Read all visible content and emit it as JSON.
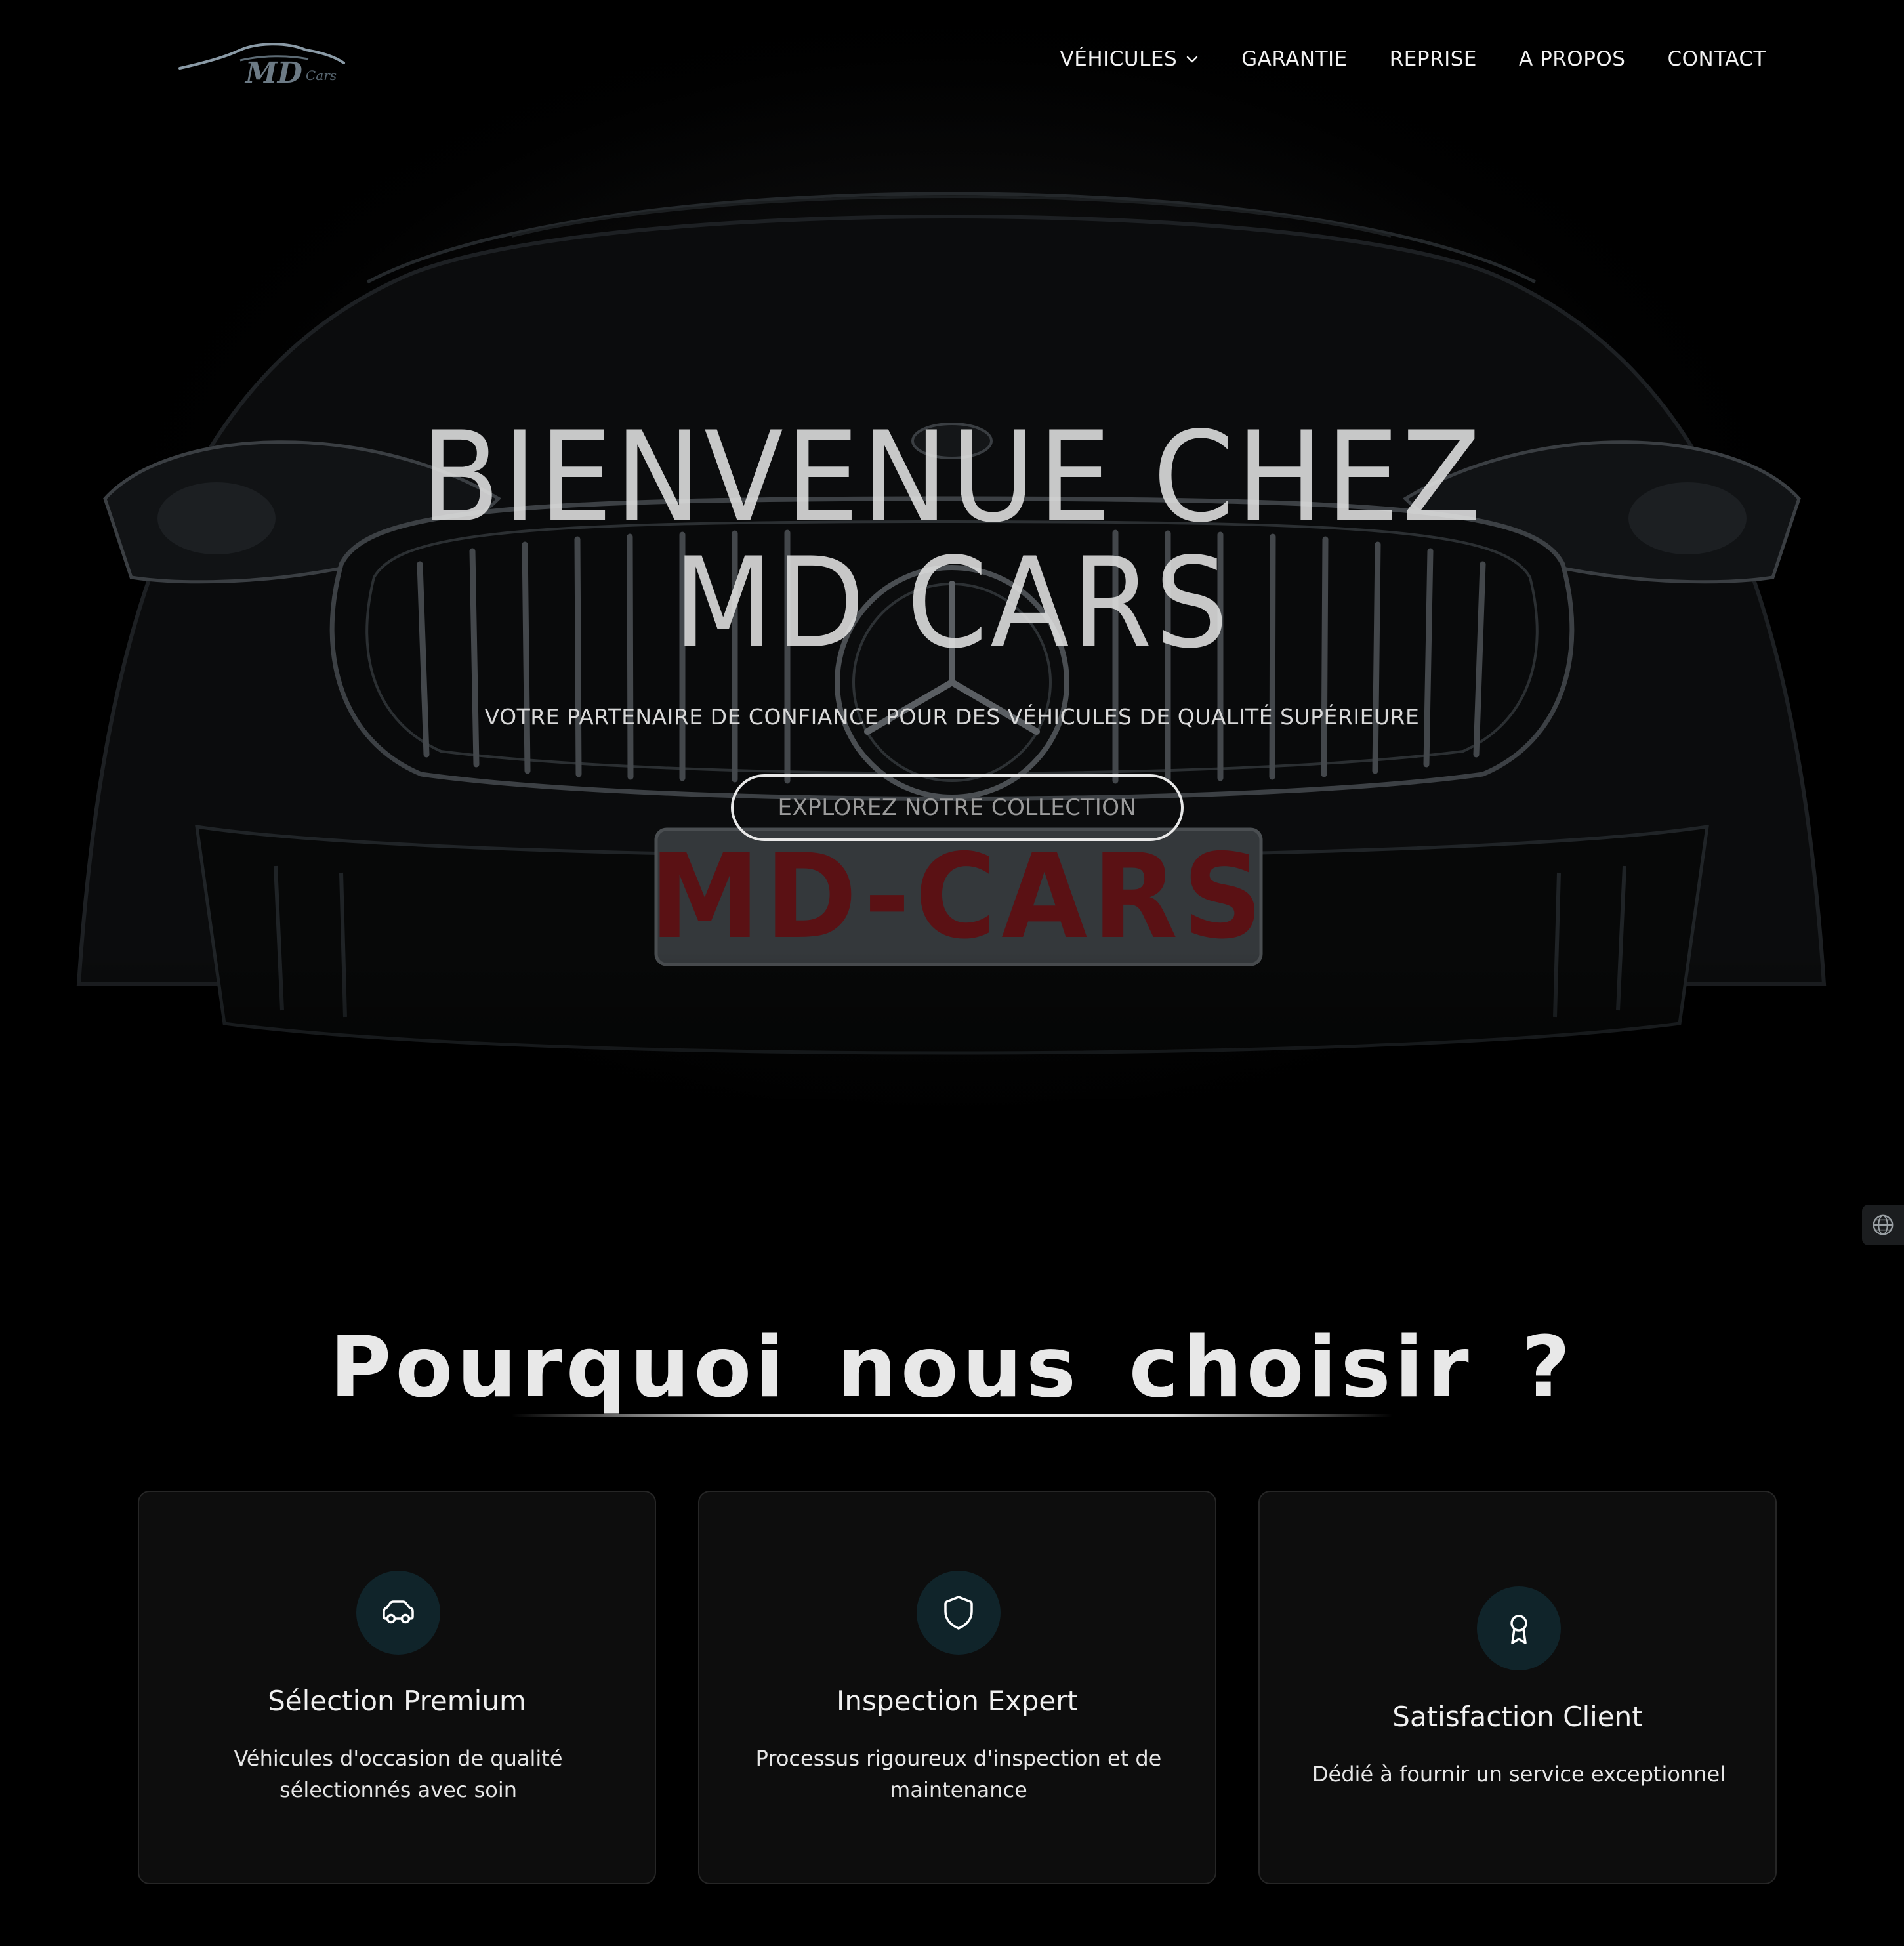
{
  "brand": {
    "logo_text": "MD",
    "logo_subtext": "Cars"
  },
  "nav": {
    "items": [
      {
        "label": "VÉHICULES",
        "has_dropdown": true
      },
      {
        "label": "GARANTIE"
      },
      {
        "label": "REPRISE"
      },
      {
        "label": "A PROPOS"
      },
      {
        "label": "CONTACT"
      }
    ]
  },
  "hero": {
    "title_line1": "BIENVENUE CHEZ",
    "title_line2": "MD CARS",
    "subtitle": "VOTRE PARTENAIRE DE CONFIANCE POUR DES VÉHICULES DE QUALITÉ SUPÉRIEURE",
    "cta_label": "EXPLOREZ NOTRE COLLECTION",
    "plate_text": "MD-CARS"
  },
  "why": {
    "title": "Pourquoi nous choisir ?",
    "cards": [
      {
        "icon": "car-icon",
        "title": "Sélection Premium",
        "text": "Véhicules d'occasion de qualité sélectionnés avec soin"
      },
      {
        "icon": "shield-icon",
        "title": "Inspection Expert",
        "text": "Processus rigoureux d'inspection et de maintenance"
      },
      {
        "icon": "award-icon",
        "title": "Satisfaction Client",
        "text": "Dédié à fournir un service exceptionnel"
      }
    ]
  },
  "side_widget": {
    "icon": "globe-icon"
  },
  "colors": {
    "background": "#000000",
    "card_bg": "#0d0d0d",
    "icon_circle": "#10242a",
    "plate_red": "#5a1114"
  }
}
